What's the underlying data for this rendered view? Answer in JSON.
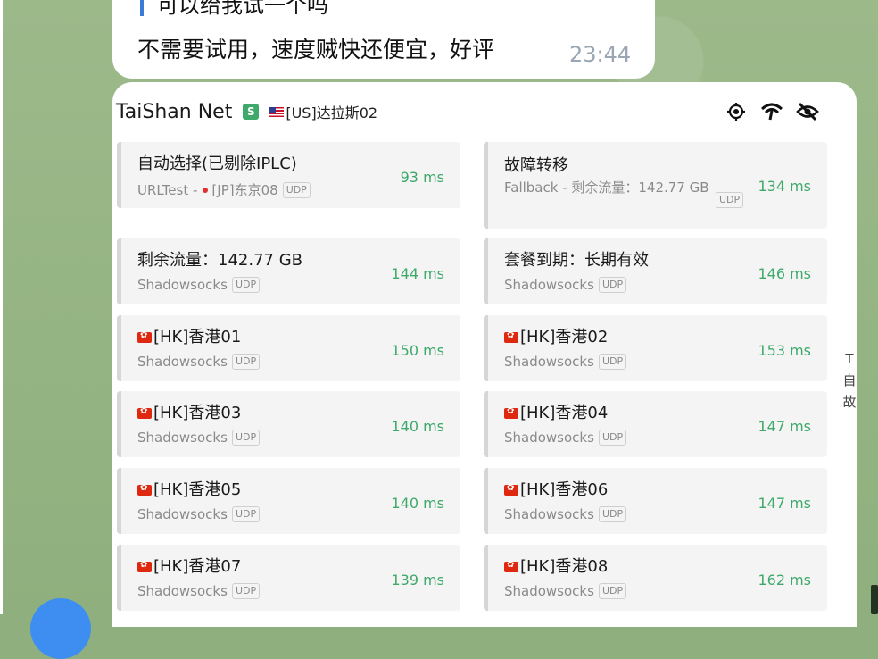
{
  "chat": {
    "quote_text": "可以给我试一个吗",
    "message_text": "不需要试用，速度贼快还便宜，好评",
    "message_time": "23:44"
  },
  "panel": {
    "provider_name": "TaiShan Net",
    "badge": "S",
    "current_node": "[US]达拉斯02",
    "icons": [
      "locate-icon",
      "wifi-icon",
      "eye-off-icon"
    ],
    "side_labels": [
      "T",
      "自",
      "故"
    ]
  },
  "proxies": [
    {
      "title": "自动选择(已剔除IPLC)",
      "type": "URLTest -",
      "extra": "[JP]东京08",
      "udp": "UDP",
      "latency": "93 ms"
    },
    {
      "title": "故障转移",
      "type": "Fallback - 剩余流量：142.77 GB",
      "udp": "UDP",
      "latency": "134 ms"
    },
    {
      "title": "剩余流量：142.77 GB",
      "type": "Shadowsocks",
      "udp": "UDP",
      "latency": "144 ms"
    },
    {
      "title": "套餐到期：长期有效",
      "type": "Shadowsocks",
      "udp": "UDP",
      "latency": "146 ms"
    },
    {
      "title": "[HK]香港01",
      "type": "Shadowsocks",
      "udp": "UDP",
      "latency": "150 ms"
    },
    {
      "title": "[HK]香港02",
      "type": "Shadowsocks",
      "udp": "UDP",
      "latency": "153 ms"
    },
    {
      "title": "[HK]香港03",
      "type": "Shadowsocks",
      "udp": "UDP",
      "latency": "140 ms"
    },
    {
      "title": "[HK]香港04",
      "type": "Shadowsocks",
      "udp": "UDP",
      "latency": "147 ms"
    },
    {
      "title": "[HK]香港05",
      "type": "Shadowsocks",
      "udp": "UDP",
      "latency": "140 ms"
    },
    {
      "title": "[HK]香港06",
      "type": "Shadowsocks",
      "udp": "UDP",
      "latency": "147 ms"
    },
    {
      "title": "[HK]香港07",
      "type": "Shadowsocks",
      "udp": "UDP",
      "latency": "139 ms"
    },
    {
      "title": "[HK]香港08",
      "type": "Shadowsocks",
      "udp": "UDP",
      "latency": "162 ms"
    }
  ],
  "colors": {
    "latency": "#3ea96a",
    "badge": "#3ea96a",
    "background": "#8fb07e",
    "quote_bar": "#3a7bd5"
  }
}
